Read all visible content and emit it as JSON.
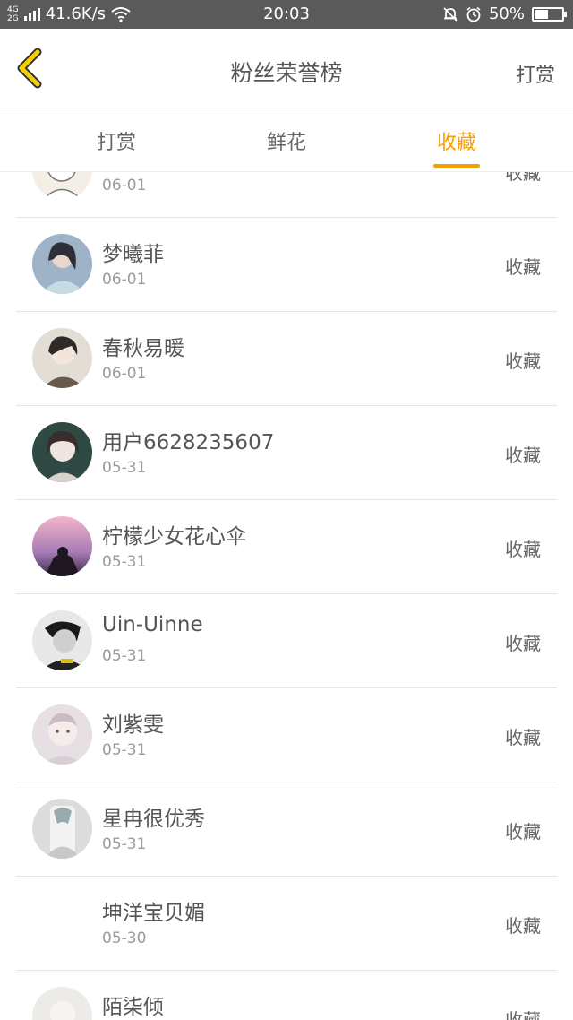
{
  "status_bar": {
    "network_top": "4G",
    "network_bottom": "2G",
    "speed": "41.6K/s",
    "time": "20:03",
    "battery": "50%",
    "battery_level": 0.5
  },
  "header": {
    "title": "粉丝荣誉榜",
    "right_label": "打赏"
  },
  "tabs": [
    {
      "label": "打赏",
      "active": false
    },
    {
      "label": "鲜花",
      "active": false
    },
    {
      "label": "收藏",
      "active": true
    }
  ],
  "list": [
    {
      "name": "",
      "date": "06-01",
      "action": "收藏",
      "avatar_color": "#f3efe6"
    },
    {
      "name": "梦曦菲",
      "date": "06-01",
      "action": "收藏",
      "avatar_color": "#9fb3c8"
    },
    {
      "name": "春秋易暖",
      "date": "06-01",
      "action": "收藏",
      "avatar_color": "#d8d4cc"
    },
    {
      "name": "用户6628235607",
      "date": "05-31",
      "action": "收藏",
      "avatar_color": "#2f4a44"
    },
    {
      "name": "柠檬少女花心伞",
      "date": "05-31",
      "action": "收藏",
      "avatar_color": "#b58bb7"
    },
    {
      "name": "Uin-Uinne",
      "date": "05-31",
      "action": "收藏",
      "avatar_color": "#2a2a2a"
    },
    {
      "name": "刘紫雯",
      "date": "05-31",
      "action": "收藏",
      "avatar_color": "#e6e0e4"
    },
    {
      "name": "星冉很优秀",
      "date": "05-31",
      "action": "收藏",
      "avatar_color": "#dcdcdc"
    },
    {
      "name": "坤洋宝贝媚",
      "date": "05-30",
      "action": "收藏",
      "avatar_color": ""
    },
    {
      "name": "陌柒倾",
      "date": "",
      "action": "收藏",
      "avatar_color": "#ecebe8"
    }
  ],
  "colors": {
    "accent": "#f5a000",
    "status_bar": "#5a5a5a",
    "back_arrow": "#f5d000"
  }
}
